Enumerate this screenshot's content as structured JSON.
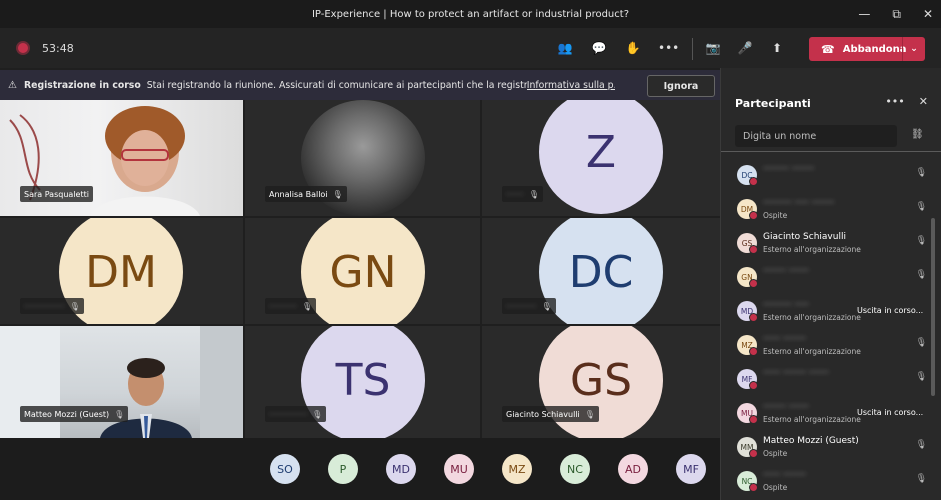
{
  "window": {
    "title": "IP-Experience | How to protect an artifact or industrial product?",
    "minimize": "—",
    "restore": "⧉",
    "close": "✕"
  },
  "toolbar": {
    "timer": "53:48",
    "icons": {
      "participants": "👥",
      "chat": "💬",
      "raise_hand": "✋",
      "more": "•••",
      "camera_off": "📷",
      "mic_off": "🎤",
      "share": "⬆"
    },
    "leave_label": "Abbandona",
    "leave_icon": "☎",
    "leave_chevron": "⌄"
  },
  "banner": {
    "icon": "⚠",
    "title": "Registrazione in corso",
    "message": "Stai registrando la riunione. Assicurati di comunicare ai partecipanti che la registrazione è in corso.",
    "link": "Informativa sulla p...",
    "ignore_button": "Ignora"
  },
  "grid": {
    "sara": {
      "name": "Sara Pasqualetti"
    },
    "annalisa": {
      "name": "Annalisa Balloi"
    },
    "z": {
      "initials": "Z",
      "name": "·······"
    },
    "dm": {
      "initials": "DM",
      "name": "················"
    },
    "gn": {
      "initials": "GN",
      "name": "···········"
    },
    "dc": {
      "initials": "DC",
      "name": "············"
    },
    "matteo": {
      "name": "Matteo Mozzi (Guest)"
    },
    "ts": {
      "initials": "TS",
      "name": "···············"
    },
    "gs": {
      "initials": "GS",
      "name": "Giacinto Schiavulli"
    },
    "mic_icon": "🎙"
  },
  "dock": [
    "SO",
    "P",
    "MD",
    "MU",
    "MZ",
    "NC",
    "AD",
    "MF"
  ],
  "panel": {
    "title": "Partecipanti",
    "more_icon": "•••",
    "close_icon": "✕",
    "search_placeholder": "Digita un nome",
    "link_icon": "⛓",
    "participants": [
      {
        "initials": "DC",
        "name": "········· ········",
        "sub": "",
        "status": ""
      },
      {
        "initials": "DM",
        "name": "·········· ····· ········",
        "sub": "Ospite",
        "status": ""
      },
      {
        "initials": "GS",
        "name": "Giacinto Schiavulli",
        "sub": "Esterno all'organizzazione",
        "status": ""
      },
      {
        "initials": "GN",
        "name": "········ ·······",
        "sub": "",
        "status": ""
      },
      {
        "initials": "MD",
        "name": "·········· ·····",
        "sub": "Esterno all'organizzazione",
        "status": "Uscita in corso..."
      },
      {
        "initials": "MZ",
        "name": "······ ········",
        "sub": "Esterno all'organizzazione",
        "status": ""
      },
      {
        "initials": "MF",
        "name": "······ ········ ·······",
        "sub": "",
        "status": ""
      },
      {
        "initials": "MU",
        "name": "········ ·······",
        "sub": "Esterno all'organizzazione",
        "status": "Uscita in corso..."
      },
      {
        "initials": "MM",
        "name": "Matteo Mozzi (Guest)",
        "sub": "Ospite",
        "status": ""
      },
      {
        "initials": "NC",
        "name": "······ ········",
        "sub": "Ospite",
        "status": ""
      }
    ]
  },
  "colors": {
    "accent_red": "#c4314b",
    "avatar_cream": "#f5e6c8",
    "avatar_lavender": "#dcd8ee",
    "avatar_blue": "#d6e1f0",
    "avatar_pink": "#f3d8e0"
  }
}
